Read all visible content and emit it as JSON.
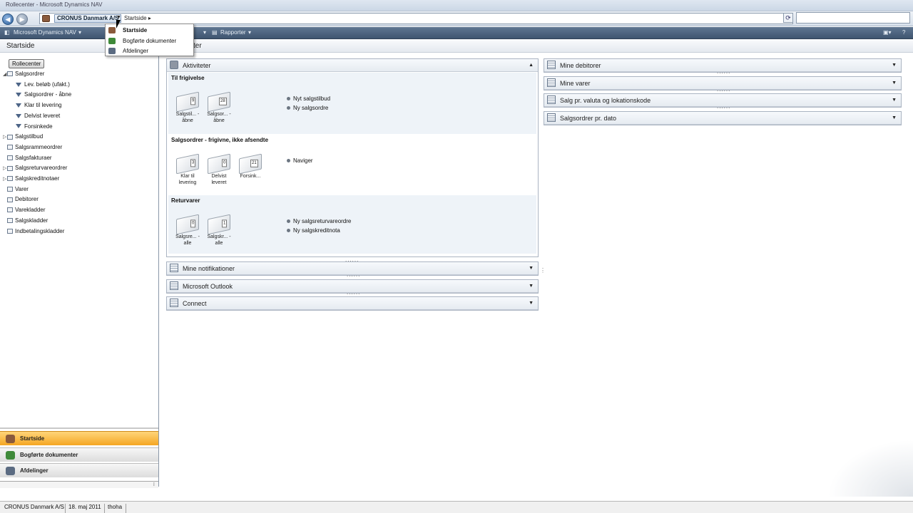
{
  "window": {
    "title": "Rollecenter - Microsoft Dynamics NAV"
  },
  "address": {
    "company": "CRONUS Danmark A/S",
    "crumb": "Startside",
    "crumb_arrow": "▸",
    "search_value": ""
  },
  "commandbar": {
    "app": "Microsoft Dynamics NAV",
    "item2": "Rapporter"
  },
  "page": {
    "title": "Startside",
    "title_partial": "ter"
  },
  "leftnav": {
    "rollecenter": "Rollecenter",
    "tree": [
      {
        "label": "Salgsordrer",
        "type": "root",
        "expanded": true
      },
      {
        "label": "Lev. beløb (ufakt.)",
        "type": "filter"
      },
      {
        "label": "Salgsordrer - åbne",
        "type": "filter"
      },
      {
        "label": "Klar til levering",
        "type": "filter"
      },
      {
        "label": "Delvist leveret",
        "type": "filter"
      },
      {
        "label": "Forsinkede",
        "type": "filter"
      },
      {
        "label": "Salgstilbud",
        "type": "root",
        "expanded": false
      },
      {
        "label": "Salgsrammeordrer",
        "type": "root"
      },
      {
        "label": "Salgsfakturaer",
        "type": "root"
      },
      {
        "label": "Salgsreturvareordrer",
        "type": "root",
        "expanded": false
      },
      {
        "label": "Salgskreditnotaer",
        "type": "root",
        "expanded": false
      },
      {
        "label": "Varer",
        "type": "root"
      },
      {
        "label": "Debitorer",
        "type": "root"
      },
      {
        "label": "Varekladder",
        "type": "root"
      },
      {
        "label": "Salgskladder",
        "type": "root"
      },
      {
        "label": "Indbetalingskladder",
        "type": "root"
      }
    ],
    "sections": [
      {
        "label": "Startside",
        "active": true
      },
      {
        "label": "Bogførte dokumenter",
        "active": false
      },
      {
        "label": "Afdelinger",
        "active": false
      }
    ]
  },
  "menu": {
    "items": [
      "Startside",
      "Bogførte dokumenter",
      "Afdelinger"
    ]
  },
  "activities": {
    "title": "Aktiviteter",
    "groups": [
      {
        "title": "Til frigivelse",
        "tiles": [
          {
            "label": "Salgstil... - åbne",
            "count": "9"
          },
          {
            "label": "Salgsor... - åbne",
            "count": "28"
          }
        ],
        "links": [
          "Nyt salgstilbud",
          "Ny salgsordre"
        ]
      },
      {
        "title": "Salgsordrer - frigivne, ikke afsendte",
        "tiles": [
          {
            "label": "Klar til levering",
            "count": "3"
          },
          {
            "label": "Delvist leveret",
            "count": "0"
          },
          {
            "label": "Forsink...",
            "count": "21"
          }
        ],
        "links": [
          "Naviger"
        ]
      },
      {
        "title": "Returvarer",
        "tiles": [
          {
            "label": "Salgsre... - alle",
            "count": "0"
          },
          {
            "label": "Salgskr... - alle",
            "count": "1"
          }
        ],
        "links": [
          "Ny salgsreturvareordre",
          "Ny salgskreditnota"
        ]
      }
    ]
  },
  "leftparts": [
    "Mine notifikationer",
    "Microsoft Outlook",
    "Connect"
  ],
  "rightparts": [
    "Mine debitorer",
    "Mine varer",
    "Salg pr. valuta og lokationskode",
    "Salgsordrer pr. dato"
  ],
  "grip": "......",
  "status": {
    "company": "CRONUS Danmark A/S",
    "date": "18. maj 2011",
    "user": "thoha"
  }
}
